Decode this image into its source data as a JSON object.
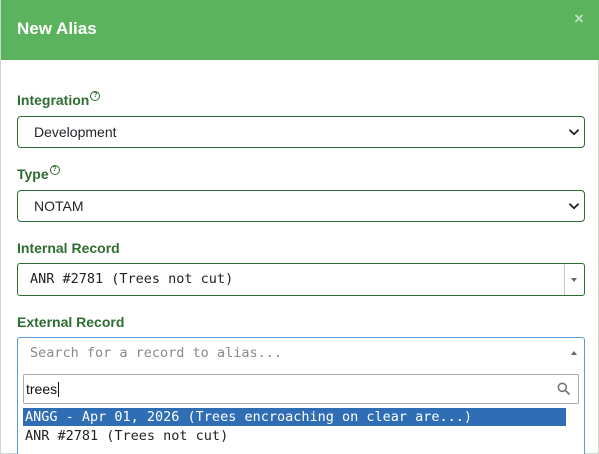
{
  "modal": {
    "title": "New Alias",
    "close_glyph": "×"
  },
  "integration": {
    "label": "Integration",
    "help_glyph": "?",
    "value": "Development"
  },
  "type": {
    "label": "Type",
    "help_glyph": "?",
    "value": "NOTAM"
  },
  "internal_record": {
    "label": "Internal Record",
    "value": "ANR #2781 (Trees not cut)"
  },
  "external_record": {
    "label": "External Record",
    "placeholder": "Search for a record to alias...",
    "search_query": "trees",
    "results": [
      {
        "text": "ANGG - Apr 01, 2026 (Trees encroaching on clear are...)",
        "highlighted": true
      },
      {
        "text": "ANR #2781 (Trees not cut)",
        "highlighted": false
      }
    ]
  },
  "colors": {
    "header_green": "#5cb35e",
    "label_green": "#2f6d33",
    "focus_blue": "#5b9bd5",
    "highlight_blue": "#2f6eb5"
  },
  "icons": [
    "close-icon",
    "help-icon",
    "chevron-down-icon",
    "search-icon"
  ]
}
